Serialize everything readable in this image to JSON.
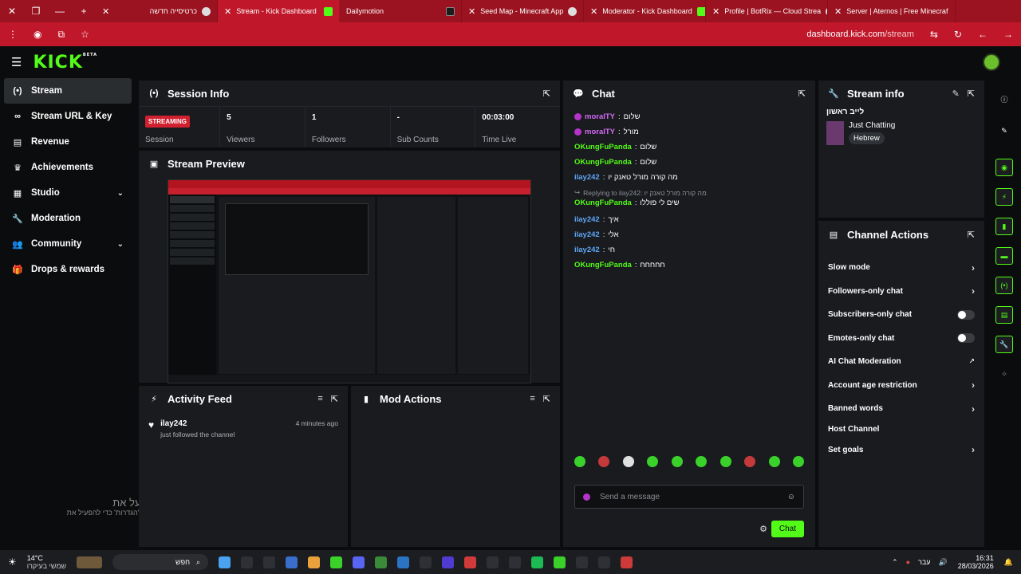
{
  "browser": {
    "tabs": [
      {
        "label": "כרטיסייה חדשה",
        "active": false,
        "icon": "chrome-icon"
      },
      {
        "label": "Stream - Kick Dashboard",
        "active": true,
        "icon": "kick-icon"
      },
      {
        "label": "Dailymotion",
        "active": false,
        "icon": "dailymotion-icon"
      },
      {
        "label": "Seed Map - Minecraft App",
        "active": false,
        "icon": "seedmap-icon"
      },
      {
        "label": "Moderator - Kick Dashboard",
        "active": false,
        "icon": "kick-icon"
      },
      {
        "label": "Profile | BotRix — Cloud Strea",
        "active": false,
        "icon": "botrix-icon"
      },
      {
        "label": "Server | Aternos | Free Minecraf",
        "active": false,
        "icon": "aternos-icon"
      }
    ],
    "url_host": "dashboard.kick.com",
    "url_path": "/stream"
  },
  "brand": {
    "logo": "KICK",
    "beta": "BETA",
    "accent": "#53fc18"
  },
  "sidebar": {
    "items": [
      {
        "label": "Stream",
        "icon": "broadcast-icon",
        "active": true
      },
      {
        "label": "Stream URL & Key",
        "icon": "link-icon"
      },
      {
        "label": "Revenue",
        "icon": "chart-icon"
      },
      {
        "label": "Achievements",
        "icon": "trophy-icon"
      },
      {
        "label": "Studio",
        "icon": "studio-icon",
        "expandable": true
      },
      {
        "label": "Moderation",
        "icon": "wrench-icon"
      },
      {
        "label": "Community",
        "icon": "users-icon",
        "expandable": true
      },
      {
        "label": "Drops & rewards",
        "icon": "gift-icon"
      }
    ]
  },
  "session": {
    "title": "Session Info",
    "status": "STREAMING",
    "status_label": "Session",
    "stats": [
      {
        "value": "5",
        "label": "Viewers"
      },
      {
        "value": "1",
        "label": "Followers"
      },
      {
        "value": "-",
        "label": "Sub Counts"
      },
      {
        "value": "00:03:00",
        "label": "Time Live"
      }
    ]
  },
  "preview": {
    "title": "Stream Preview"
  },
  "activity": {
    "title": "Activity Feed",
    "items": [
      {
        "user": "ilay242",
        "text": "just followed the channel",
        "time": "4 minutes ago"
      }
    ]
  },
  "mod_actions": {
    "title": "Mod Actions"
  },
  "chat": {
    "title": "Chat",
    "messages": [
      {
        "user": "moralTY",
        "text": "שלום",
        "color": "#d46bf5",
        "mic": true
      },
      {
        "user": "moralTY",
        "text": "מורל",
        "color": "#d46bf5",
        "mic": true
      },
      {
        "user": "OKungFuPanda",
        "text": "שלום",
        "color": "#53fc18"
      },
      {
        "user": "OKungFuPanda",
        "text": "שלום",
        "color": "#53fc18"
      },
      {
        "user": "ilay242",
        "text": "מה קורה מורל טאנק יו",
        "color": "#5ea6f5"
      },
      {
        "user": "OKungFuPanda",
        "text": "שים לי פוללו",
        "color": "#53fc18",
        "reply": "Replying to ilay242: מה קורה מורל טאנק יו"
      },
      {
        "user": "ilay242",
        "text": "איך",
        "color": "#5ea6f5"
      },
      {
        "user": "ilay242",
        "text": "אלי",
        "color": "#5ea6f5"
      },
      {
        "user": "ilay242",
        "text": "חי",
        "color": "#5ea6f5"
      },
      {
        "user": "OKungFuPanda",
        "text": "חחחחח",
        "color": "#53fc18"
      }
    ],
    "placeholder": "Send a message",
    "send_label": "Chat"
  },
  "stream_info": {
    "title": "Stream info",
    "stream_title": "לייב ראשון",
    "category": "Just Chatting",
    "tag": "Hebrew"
  },
  "channel_actions": {
    "title": "Channel Actions",
    "items": [
      {
        "label": "Slow mode",
        "control": "chevron"
      },
      {
        "label": "Followers-only chat",
        "control": "chevron"
      },
      {
        "label": "Subscribers-only chat",
        "control": "toggle"
      },
      {
        "label": "Emotes-only chat",
        "control": "toggle"
      },
      {
        "label": "AI Chat Moderation",
        "control": "external"
      },
      {
        "label": "Account age restriction",
        "control": "chevron"
      },
      {
        "label": "Banned words",
        "control": "chevron"
      },
      {
        "label": "Host Channel",
        "control": "none"
      },
      {
        "label": "Set goals",
        "control": "chevron"
      }
    ]
  },
  "windows_watermark": {
    "line1": "הפעל את Windows",
    "line2": "עבור אל 'הגדרות' כדי להפעיל את Windows."
  },
  "taskbar": {
    "time": "16:31",
    "date": "28/03/2026",
    "lang": "עבר",
    "search": "חפש",
    "weather_temp": "14°C",
    "weather_text": "שמשי בעיקרו"
  }
}
